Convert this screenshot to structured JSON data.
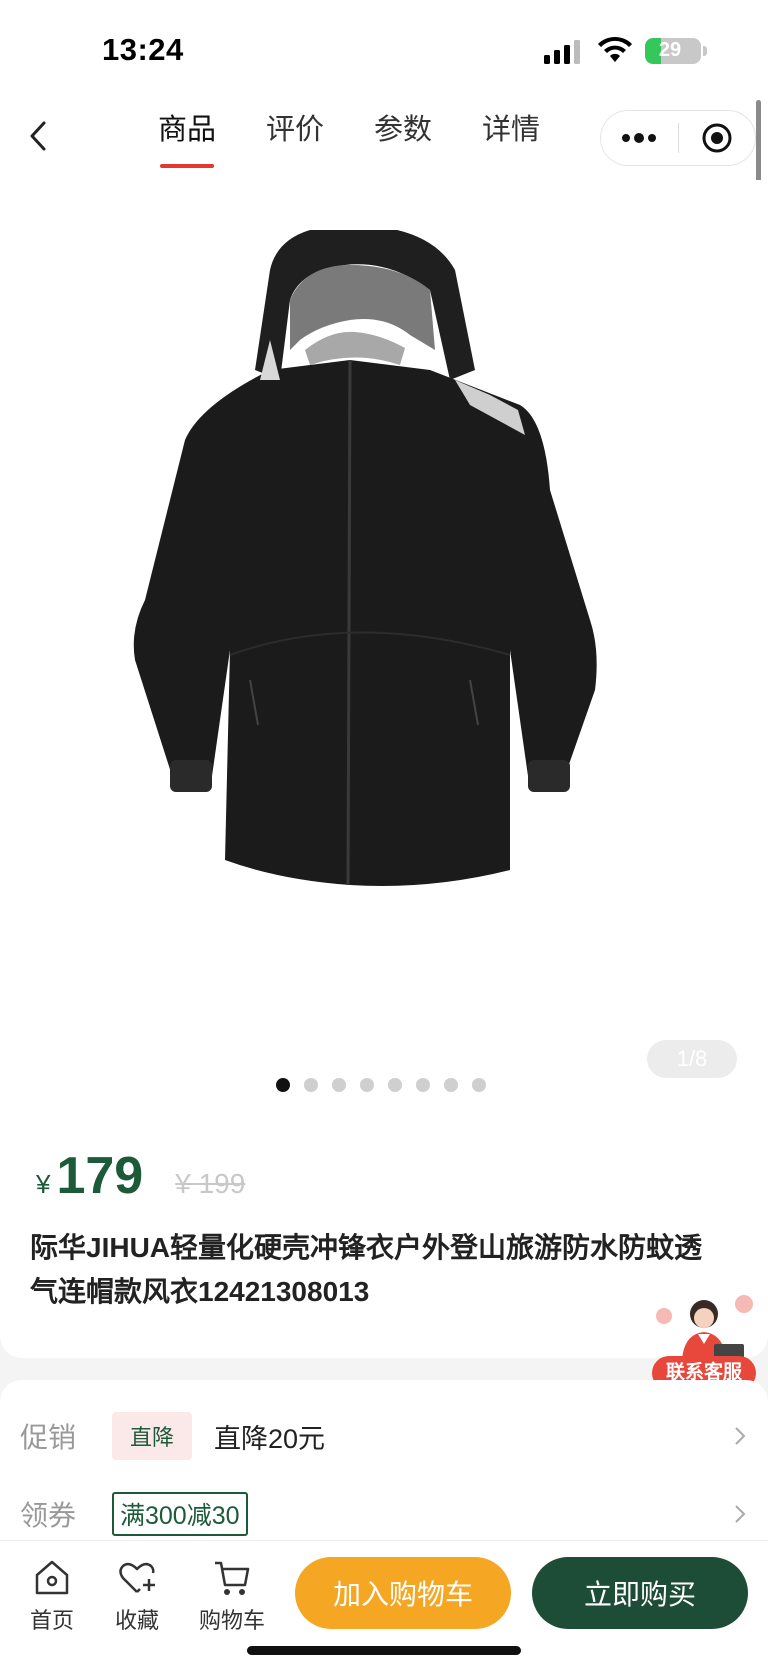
{
  "status_bar": {
    "time": "13:24",
    "battery": "29",
    "battery_level": 0.29
  },
  "nav": {
    "tabs": [
      {
        "label": "商品",
        "active": true
      },
      {
        "label": "评价",
        "active": false
      },
      {
        "label": "参数",
        "active": false
      },
      {
        "label": "详情",
        "active": false
      }
    ],
    "icons": {
      "back": "chevron-left-icon",
      "more": "more-dots-icon",
      "close": "target-circle-icon"
    }
  },
  "gallery": {
    "counter": "1/8",
    "current_index": 1,
    "total": 8
  },
  "product": {
    "currency": "¥",
    "price": "179",
    "original_price": "¥ 199",
    "title": "际华JIHUA轻量化硬壳冲锋衣户外登山旅游防水防蚊透气连帽款风衣12421308013"
  },
  "customer_service": {
    "label": "联系客服"
  },
  "promos": {
    "promotion": {
      "label": "促销",
      "tag": "直降",
      "text": "直降20元"
    },
    "coupon": {
      "label": "领券",
      "tag": "满300减30"
    }
  },
  "bottom_bar": {
    "home": "首页",
    "favorite": "收藏",
    "cart": "购物车",
    "add_to_cart": "加入购物车",
    "buy_now": "立即购买"
  },
  "colors": {
    "accent_green": "#1d5a3a",
    "tab_underline": "#e2382f",
    "cart_orange": "#f5a623",
    "buy_green": "#1d4d36"
  }
}
